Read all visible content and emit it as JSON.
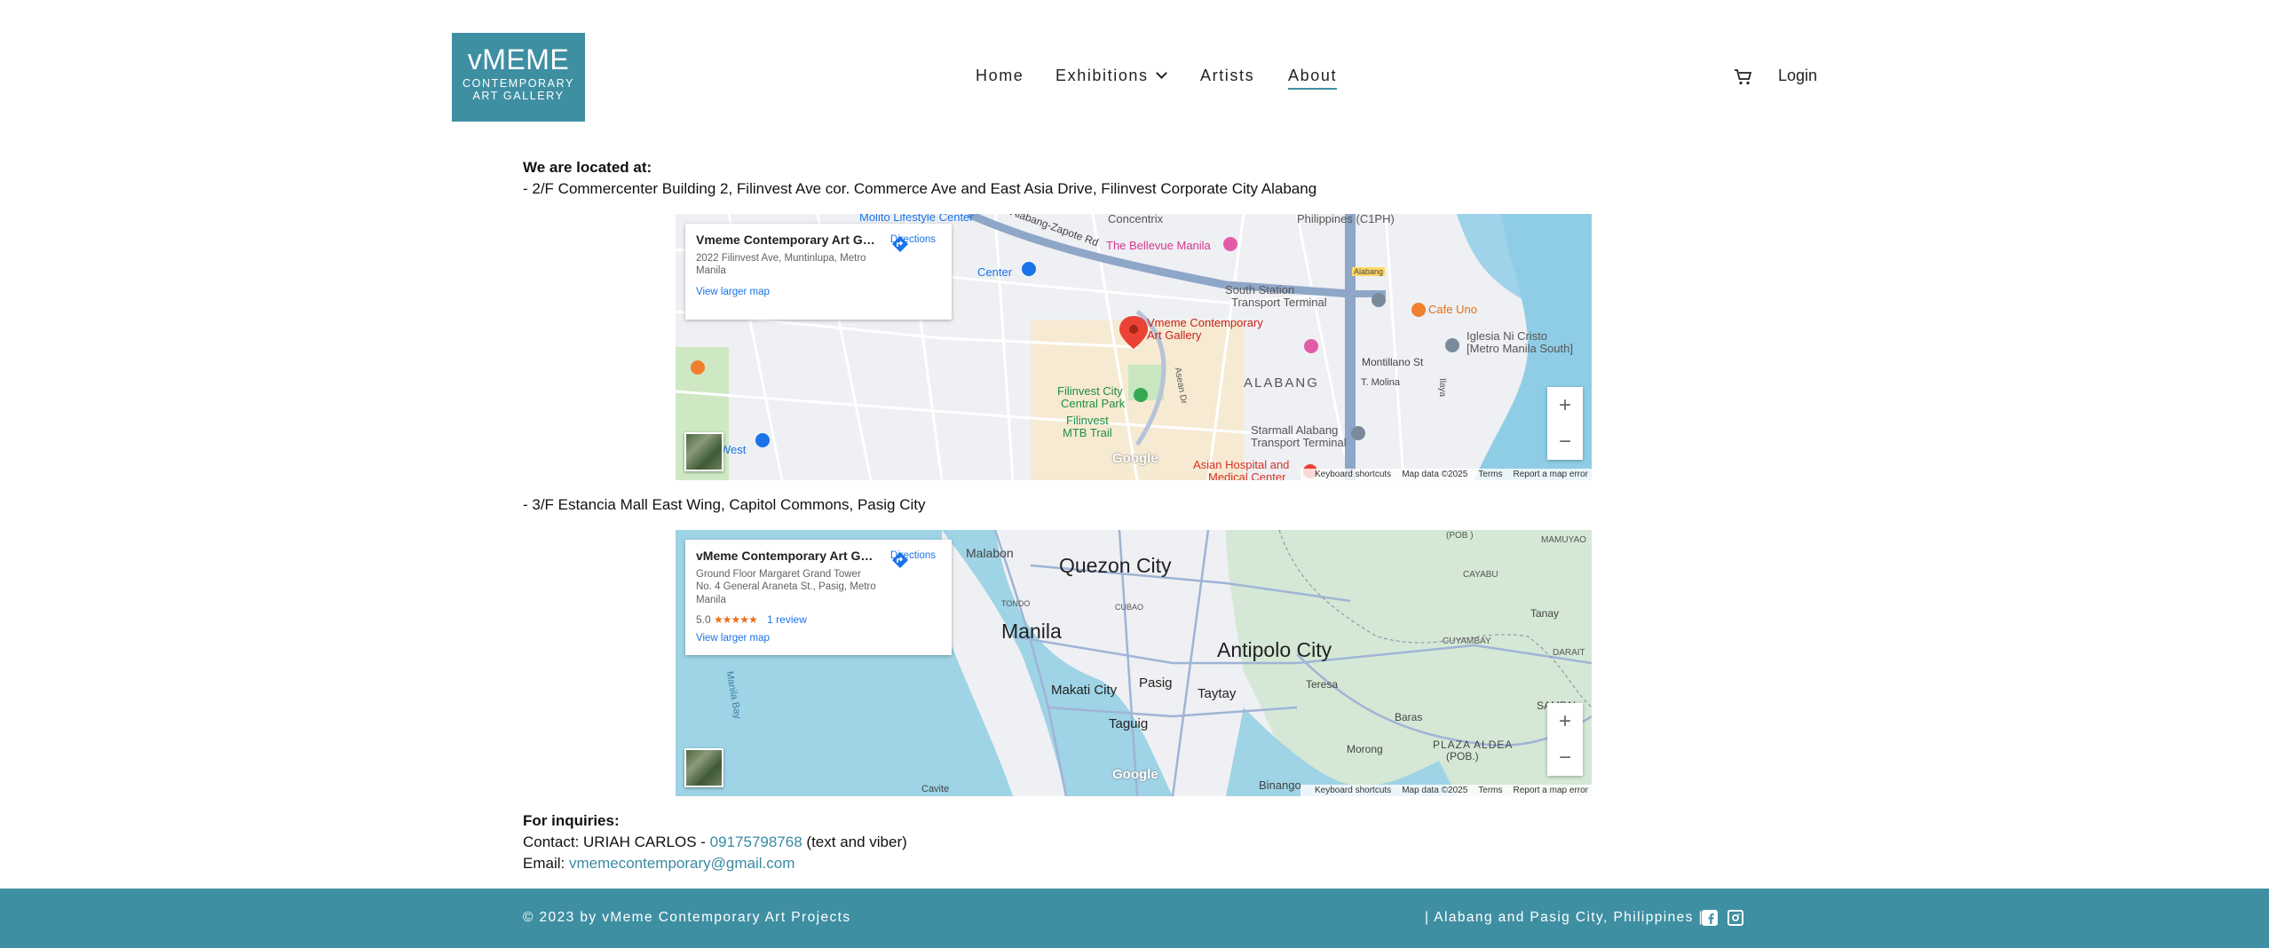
{
  "logo": {
    "title": "vMEME",
    "line1": "CONTEMPORARY",
    "line2": "ART GALLERY"
  },
  "nav": {
    "home": "Home",
    "exhibitions": "Exhibitions",
    "artists": "Artists",
    "about": "About",
    "login": "Login"
  },
  "content": {
    "located_heading": "We are located at:",
    "location1": "- 2/F Commercenter Building 2, Filinvest Ave cor. Commerce Ave and East Asia Drive, Filinvest Corporate City Alabang",
    "location2": "- 3/F Estancia Mall East Wing, Capitol Commons, Pasig City",
    "inquiries_heading": "For inquiries:",
    "contact_prefix": "Contact: URIAH CARLOS - ",
    "phone": "09175798768",
    "contact_suffix": " (text and viber)",
    "email_prefix": "Email: ",
    "email": "vmemecontemporary@gmail.com"
  },
  "map1": {
    "card_title": "Vmeme Contemporary Art Gal...",
    "card_address": "2022 Filinvest Ave, Muntinlupa, Metro Manila",
    "directions": "Directions",
    "view_larger": "View larger map",
    "pin_label_1": "Vmeme Contemporary",
    "pin_label_2": "Art Gallery",
    "labels": [
      "Molito Lifestyle Center",
      "Alabang-Zapote Rd",
      "Concentrix",
      "Philippines (C1PH)",
      "The Bellevue Manila",
      "Alabang",
      "South Station",
      "Transport Terminal",
      "Cafe Uno",
      "Iglesia Ni Cristo",
      "[Metro Manila South]",
      "Montillano St",
      "T. Molina",
      "ALABANG",
      "Filinvest City",
      "Central Park",
      "Filinvest",
      "MTB Trail",
      "Starmall Alabang",
      "Transport Terminal",
      "Asian Hospital and",
      "Medical Center",
      "Center",
      "West",
      "Asean Dr",
      "Ilaya"
    ],
    "zoom_in": "+",
    "zoom_out": "−",
    "attribution": {
      "shortcuts": "Keyboard shortcuts",
      "mapdata": "Map data ©2025",
      "terms": "Terms",
      "report": "Report a map error"
    },
    "google": "Google"
  },
  "map2": {
    "card_title": "vMeme Contemporary Art Gall...",
    "card_address": "Ground Floor Margaret Grand Tower No. 4 General Araneta St., Pasig, Metro Manila",
    "rating": "5.0",
    "stars": "★★★★★",
    "reviews": "1 review",
    "directions": "Directions",
    "view_larger": "View larger map",
    "labels": [
      "Malabon",
      "Quezon City",
      "Manila",
      "Antipolo City",
      "Makati City",
      "Pasig",
      "Taytay",
      "Taguig",
      "Teresa",
      "Baras",
      "Morong",
      "PLAZA ALDEA",
      "(POB.)",
      "SAMPAL",
      "Tanay",
      "CAYABU",
      "CUYAMBAY",
      "DARAIT",
      "MAMUYAO",
      "(POB )",
      "Manila Bay",
      "Cavite",
      "Binango",
      "TONDO",
      "CUBAO"
    ],
    "zoom_in": "+",
    "zoom_out": "−",
    "attribution": {
      "shortcuts": "Keyboard shortcuts",
      "mapdata": "Map data ©2025",
      "terms": "Terms",
      "report": "Report a map error"
    },
    "google": "Google"
  },
  "footer": {
    "copyright": "© 2023 by vMeme Contemporary Art Projects",
    "location": "| Alabang and Pasig City, Philippines |"
  },
  "colors": {
    "brand": "#3f8fa3",
    "link": "#3a8aa1"
  }
}
